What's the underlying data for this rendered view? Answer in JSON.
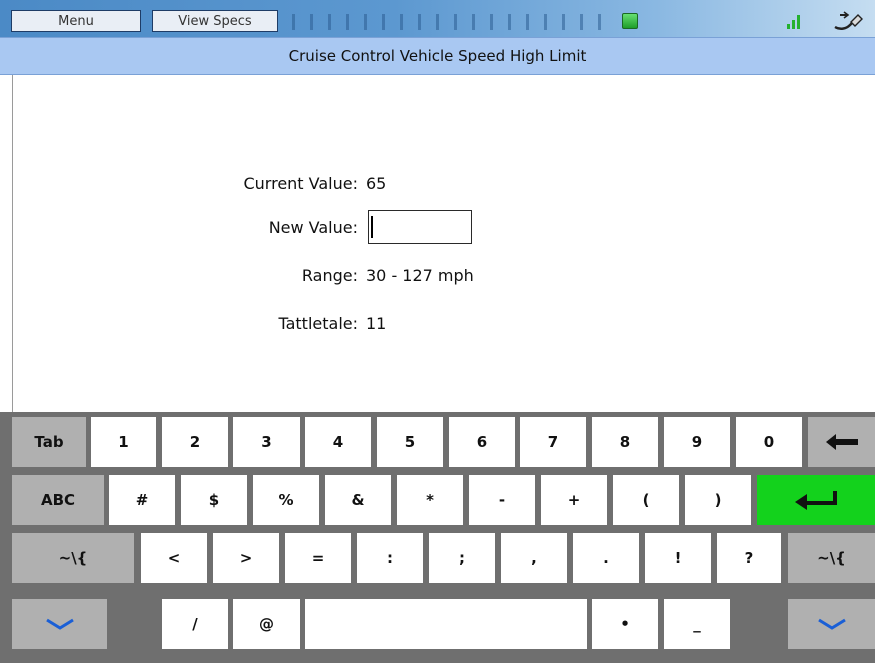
{
  "toolbar": {
    "menu_label": "Menu",
    "viewspecs_label": "View Specs"
  },
  "header": {
    "title": "Cruise Control Vehicle Speed High Limit"
  },
  "form": {
    "current_value_label": "Current Value:",
    "current_value": "65",
    "new_value_label": "New Value:",
    "new_value": "",
    "range_label": "Range:",
    "range_value": "30 - 127 mph",
    "tattletale_label": "Tattletale:",
    "tattletale_value": "11"
  },
  "keyboard": {
    "row1": [
      "Tab",
      "1",
      "2",
      "3",
      "4",
      "5",
      "6",
      "7",
      "8",
      "9",
      "0"
    ],
    "row2": [
      "ABC",
      "#",
      "$",
      "%",
      "&",
      "*",
      "-",
      "+",
      "(",
      ")"
    ],
    "row3": [
      "~\\{",
      "<",
      ">",
      "=",
      ":",
      ";",
      ",",
      ".",
      "!",
      "?",
      "~\\{"
    ],
    "row4": [
      "/",
      "@",
      "•",
      "_"
    ]
  },
  "colors": {
    "title_bar": "#a9c8f2",
    "enter_key": "#13d21c",
    "chevron": "#1a5fd6"
  },
  "icons": [
    "green-status-indicator-icon",
    "signal-strength-icon",
    "connector-plug-icon",
    "backspace-icon",
    "enter-icon",
    "hide-keyboard-icon"
  ]
}
